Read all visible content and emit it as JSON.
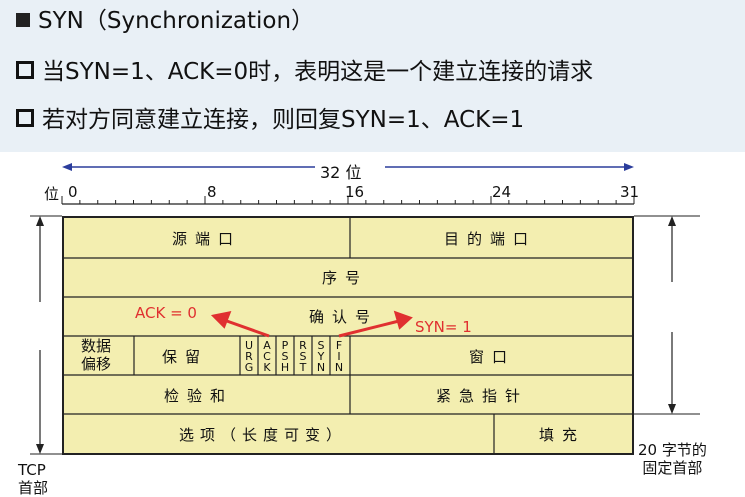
{
  "slide": {
    "heading": "SYN（Synchronization）",
    "point1": "当SYN=1、ACK=0时，表明这是一个建立连接的请求",
    "point2": "若对方同意建立连接，则回复SYN=1、ACK=1"
  },
  "diagram": {
    "width_label": "32 位",
    "bit_axis_label": "位",
    "bit_ticks": [
      "0",
      "8",
      "16",
      "24",
      "31"
    ],
    "rows": {
      "src_port": "源端口",
      "dst_port": "目的端口",
      "seq": "序号",
      "ack_num": "确认号",
      "data_offset": "数据\n偏移",
      "reserved": "保留",
      "window": "窗口",
      "checksum": "检验和",
      "urgent_ptr": "紧急指针",
      "options": "选项（长度可变）",
      "padding": "填充"
    },
    "flags": [
      "URG",
      "ACK",
      "PSH",
      "RST",
      "SYN",
      "FIN"
    ],
    "tcp_label": "TCP\n首部",
    "fixed_label": "20 字节的\n固定首部",
    "annotations": {
      "ack": "ACK = 0",
      "syn": "SYN= 1"
    },
    "colors": {
      "table_fill": "#f3eeb0",
      "annotation": "#e03030",
      "arrow_blue": "#2b3d9c"
    }
  }
}
